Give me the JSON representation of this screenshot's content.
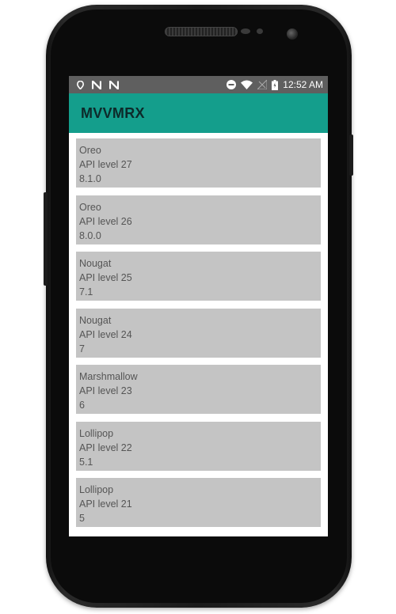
{
  "status_bar": {
    "time": "12:52 AM",
    "left_icons": [
      "location-icon",
      "n-notification-icon",
      "n-notification-icon"
    ],
    "right_icons": [
      "do-not-disturb-icon",
      "wifi-icon",
      "no-signal-icon",
      "battery-icon"
    ]
  },
  "app_bar": {
    "title": "MVVMRX",
    "color": "#149e8c"
  },
  "versions": [
    {
      "name": "Oreo",
      "api": "API level 27",
      "version": "8.1.0"
    },
    {
      "name": "Oreo",
      "api": "API level 26",
      "version": "8.0.0"
    },
    {
      "name": "Nougat",
      "api": "API level 25",
      "version": "7.1"
    },
    {
      "name": "Nougat",
      "api": "API level 24",
      "version": "7"
    },
    {
      "name": "Marshmallow",
      "api": "API level 23",
      "version": "6"
    },
    {
      "name": "Lollipop",
      "api": "API level 22",
      "version": "5.1"
    },
    {
      "name": "Lollipop",
      "api": "API level 21",
      "version": "5"
    }
  ]
}
